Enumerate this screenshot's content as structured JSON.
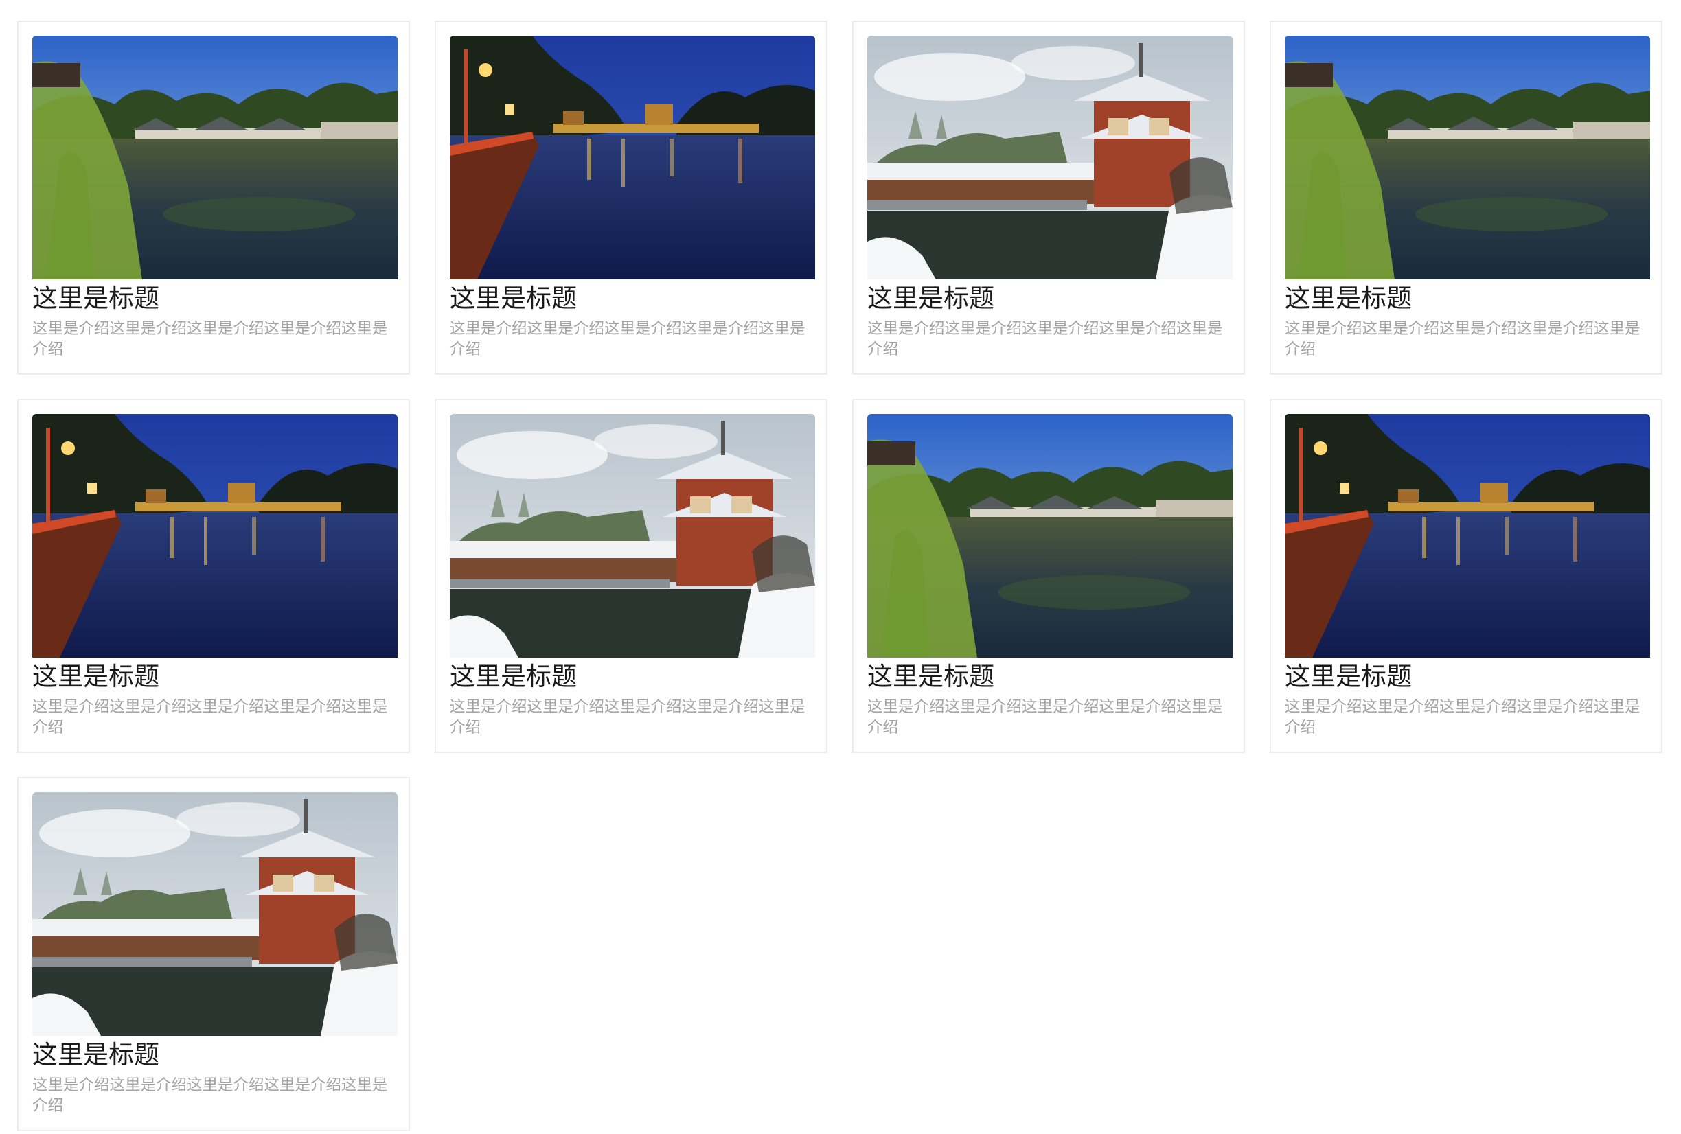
{
  "cards": [
    {
      "title": "这里是标题",
      "description": "这里是介绍这里是介绍这里是介绍这里是介绍这里是介绍",
      "image": "summer-palace-willow-pond-photo"
    },
    {
      "title": "这里是标题",
      "description": "这里是介绍这里是介绍这里是介绍这里是介绍这里是介绍",
      "image": "night-river-town-bridge-photo"
    },
    {
      "title": "这里是标题",
      "description": "这里是介绍这里是介绍这里是介绍这里是介绍这里是介绍",
      "image": "snowy-pagoda-garden-photo"
    },
    {
      "title": "这里是标题",
      "description": "这里是介绍这里是介绍这里是介绍这里是介绍这里是介绍",
      "image": "summer-palace-willow-pond-photo"
    },
    {
      "title": "这里是标题",
      "description": "这里是介绍这里是介绍这里是介绍这里是介绍这里是介绍",
      "image": "night-river-town-bridge-photo"
    },
    {
      "title": "这里是标题",
      "description": "这里是介绍这里是介绍这里是介绍这里是介绍这里是介绍",
      "image": "snowy-pagoda-garden-photo"
    },
    {
      "title": "这里是标题",
      "description": "这里是介绍这里是介绍这里是介绍这里是介绍这里是介绍",
      "image": "summer-palace-willow-pond-photo"
    },
    {
      "title": "这里是标题",
      "description": "这里是介绍这里是介绍这里是介绍这里是介绍这里是介绍",
      "image": "night-river-town-bridge-photo"
    },
    {
      "title": "这里是标题",
      "description": "这里是介绍这里是介绍这里是介绍这里是介绍这里是介绍",
      "image": "snowy-pagoda-garden-photo"
    }
  ],
  "colors": {
    "card_border": "#ececec",
    "title_text": "#1a1a1a",
    "description_text": "#a3a3a3"
  }
}
